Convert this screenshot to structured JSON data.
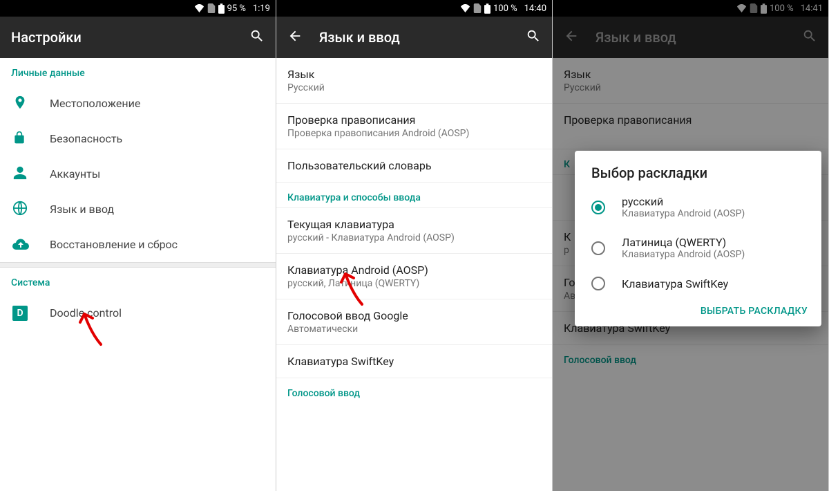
{
  "screen1": {
    "status": {
      "battery": "95 %",
      "time": "1:19"
    },
    "title": "Настройки",
    "section_personal": "Личные данные",
    "items": {
      "location": "Местоположение",
      "security": "Безопасность",
      "accounts": "Аккаунты",
      "lang": "Язык и ввод",
      "backup": "Восстановление и сброс"
    },
    "section_system": "Система",
    "doodle": "Doodle control",
    "doodle_badge": "D"
  },
  "screen2": {
    "status": {
      "battery": "100 %",
      "time": "14:40"
    },
    "title": "Язык и ввод",
    "lang": {
      "t": "Язык",
      "s": "Русский"
    },
    "spell": {
      "t": "Проверка правописания",
      "s": "Проверка правописания Android (AOSP)"
    },
    "dict": {
      "t": "Пользовательский словарь"
    },
    "section_kb": "Клавиатура и способы ввода",
    "current": {
      "t": "Текущая клавиатура",
      "s": "русский - Клавиатура Android (AOSP)"
    },
    "aosp": {
      "t": "Клавиатура Android (AOSP)",
      "s": "русский, Латиница (QWERTY)"
    },
    "gvoice": {
      "t": "Голосовой ввод Google",
      "s": "Автоматически"
    },
    "swiftkey": {
      "t": "Клавиатура SwiftKey"
    },
    "section_voice": "Голосовой ввод"
  },
  "screen3": {
    "status": {
      "battery": "100 %",
      "time": "14:41"
    },
    "title": "Язык и ввод",
    "bg": {
      "lang": {
        "t": "Язык",
        "s": "Русский"
      },
      "spell": {
        "t": "Проверка правописания"
      },
      "section_kb_short": "К",
      "aosp_short": {
        "t": "К",
        "s": "р"
      },
      "gvoice": {
        "t": "Голосовой ввод Google",
        "s": "Автоматически"
      },
      "swiftkey": {
        "t": "Клавиатура SwiftKey"
      },
      "section_voice": "Голосовой ввод"
    },
    "dialog": {
      "title": "Выбор раскладки",
      "opt1": {
        "t": "русский",
        "s": "Клавиатура Android (AOSP)"
      },
      "opt2": {
        "t": "Латиница (QWERTY)",
        "s": "Клавиатура Android (AOSP)"
      },
      "opt3": {
        "t": "Клавиатура SwiftKey"
      },
      "action": "ВЫБРАТЬ РАСКЛАДКУ"
    }
  }
}
